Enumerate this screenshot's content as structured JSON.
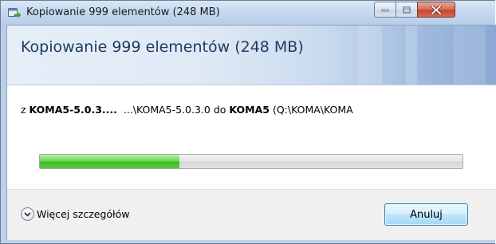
{
  "window": {
    "title": "Kopiowanie 999 elementów (248 MB)",
    "caption_buttons": {
      "minimize_icon": "minimize-icon",
      "maximize_icon": "maximize-icon",
      "close_icon": "close-icon"
    }
  },
  "banner": {
    "title": "Kopiowanie 999 elementów (248 MB)"
  },
  "details": {
    "from_prefix": "z",
    "source_name": "KOMA5-5.0.3....",
    "source_path": "...\\KOMA5-5.0.3.0",
    "to_word": "do",
    "dest_name": "KOMA5",
    "dest_path": "(Q:\\KOMA\\KOMA"
  },
  "progress": {
    "fraction": 0.33,
    "color": "#3fbd26"
  },
  "footer": {
    "more_details_label": "Więcej szczegółów",
    "cancel_label": "Anuluj"
  },
  "colors": {
    "title_text": "#1e3a5f",
    "close_button": "#c8462c",
    "accent_button_border": "#3c7fb1"
  }
}
